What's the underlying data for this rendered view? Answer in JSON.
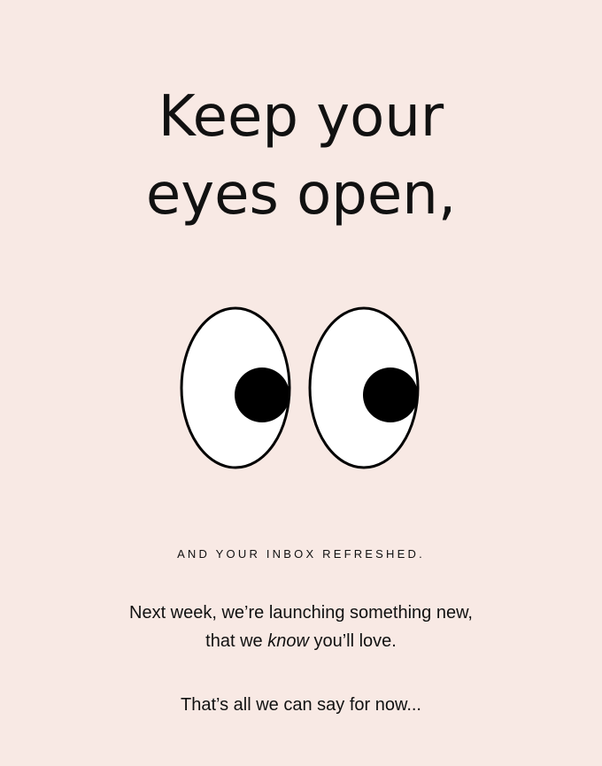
{
  "headline": {
    "line1": "Keep your",
    "line2": "eyes open,"
  },
  "illustration": {
    "icon": "googly-eyes-icon"
  },
  "tagline": "AND YOUR INBOX REFRESHED.",
  "body": {
    "line1": "Next week, we’re launching something new,",
    "line2_before": "that we ",
    "line2_emphasis": "know",
    "line2_after": " you’ll love.",
    "signoff": "That’s all we can say for now..."
  },
  "colors": {
    "background": "#f8e9e4",
    "text": "#111111",
    "eye_white": "#ffffff",
    "pupil": "#000000"
  }
}
